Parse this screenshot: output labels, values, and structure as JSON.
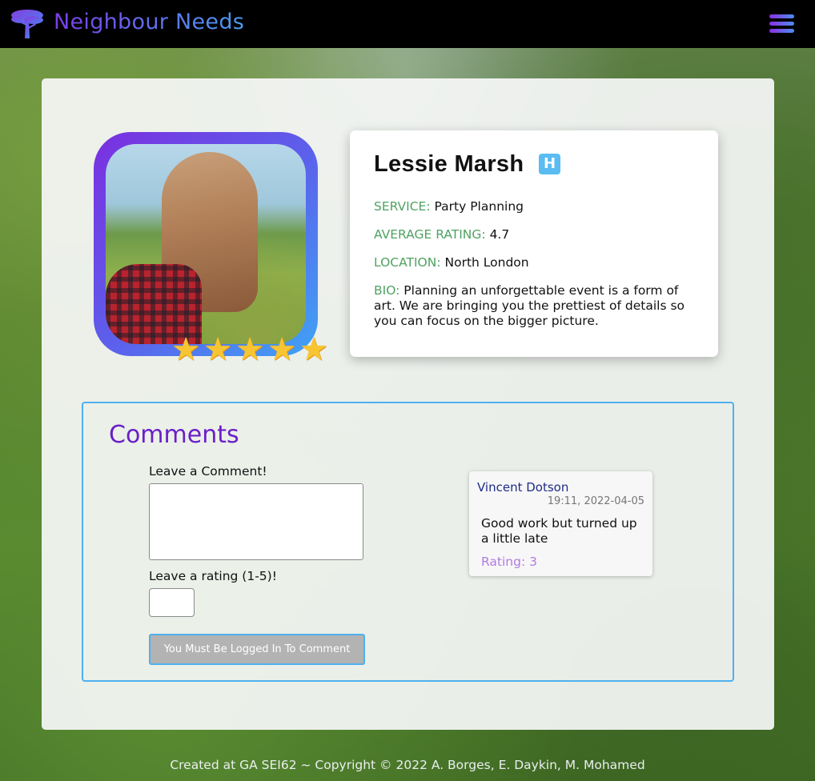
{
  "navbar": {
    "brand": "Neighbour Needs",
    "logo_icon": "tree-icon",
    "menu_icon": "hamburger-icon"
  },
  "profile": {
    "name": "Lessie Marsh",
    "badge": "H",
    "service_label": "SERVICE:",
    "service": "Party Planning",
    "rating_label": "AVERAGE RATING:",
    "rating": "4.7",
    "location_label": "LOCATION:",
    "location": "North London",
    "bio_label": "BIO:",
    "bio": "Planning an unforgettable event is a form of art. We are bringing you the prettiest of details so you can focus on the bigger picture.",
    "stars": 5
  },
  "comments": {
    "title": "Comments",
    "comment_label": "Leave a Comment!",
    "rating_label": "Leave a rating (1-5)!",
    "submit_label": "You Must Be Logged In To Comment",
    "items": [
      {
        "author": "Vincent Dotson",
        "time": "19:11, 2022-04-05",
        "text": "Good work but turned up a little late",
        "rating": "Rating: 3"
      }
    ]
  },
  "footer": {
    "text": "Created at GA SEI62 ~ Copyright © 2022 A. Borges, E. Daykin, M. Mohamed"
  },
  "colors": {
    "accent_purple": "#6a1fc8",
    "accent_blue": "#4fb0ee",
    "label_green": "#4fa261"
  }
}
